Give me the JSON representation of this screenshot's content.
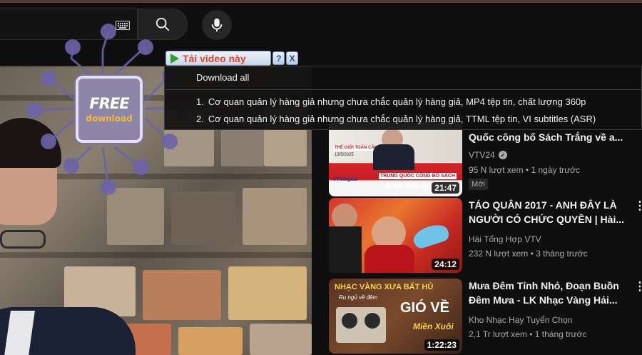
{
  "topbar": {
    "keyboard_icon": "keyboard-icon",
    "search_icon": "search-icon",
    "mic_icon": "microphone-icon"
  },
  "logo": {
    "free_text": "FREE",
    "download_text": "download",
    "colors": {
      "card": "#8e86a8",
      "accent": "#f2b733",
      "network": "#6c63a8"
    }
  },
  "downloader": {
    "title": "Tải video này",
    "help_label": "?",
    "close_label": "X",
    "download_all": "Download all",
    "items": [
      {
        "number": "1.",
        "text": "Cơ quan quản lý hàng giả nhưng chưa chắc quản lý hàng giả,  MP4 tệp tin, chất lượng 360p"
      },
      {
        "number": "2.",
        "text": "Cơ quan quản lý hàng giả nhưng chưa chắc quản lý hàng giả,  TTML tệp tin, VI subtitles (ASR)"
      }
    ]
  },
  "recommendations": [
    {
      "title": "Quốc công bố Sách Trắng về a...",
      "channel": "VTV24",
      "verified": true,
      "meta": "95 N lượt xem • 1 ngày trước",
      "badge": "Mới",
      "duration": "21:47",
      "thumb_text": {
        "top": "THẾ GIỚI TOÀN CẢNH",
        "date": "13/5/2025",
        "brand": "VTVdigital",
        "line1": "TRUNG QUỐC CÔNG BỐ SÁCH",
        "line2": "VỀ AN NINH QUỐC"
      }
    },
    {
      "title": "TÁO QUÂN 2017 - ANH ĐÂY LÀ NGƯỜI CÓ CHỨC QUYỀN | Hài...",
      "channel": "Hài Tổng Hợp VTV",
      "verified": false,
      "meta": "232 N lượt xem • 3 tháng trước",
      "duration": "24:12"
    },
    {
      "title": "Mưa Đêm Tỉnh Nhỏ, Đoạn Buồn Đêm Mưa - LK Nhạc Vàng Hải...",
      "channel": "Kho Nhạc Hay Tuyển Chọn",
      "verified": false,
      "meta": "2,1 Tr lượt xem • 1 tháng trước",
      "duration": "1:22:23",
      "thumb_text": {
        "line1": "NHẠC VÀNG XƯA BẤT HỦ",
        "line2": "Ru ngủ về đêm",
        "line3": "GIÓ VỀ",
        "line4": "Miền Xuôi"
      }
    }
  ]
}
